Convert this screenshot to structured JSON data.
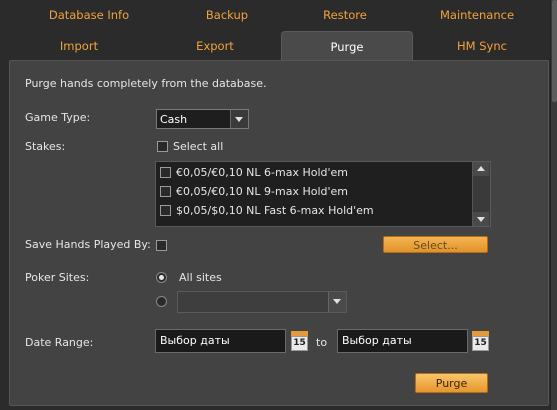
{
  "tabs": {
    "row1": [
      "Database Info",
      "Backup",
      "Restore",
      "Maintenance"
    ],
    "row2": [
      "Import",
      "Export",
      "Purge",
      "HM Sync"
    ],
    "active": "Purge"
  },
  "purge": {
    "description": "Purge hands completely from the database.",
    "game_type_label": "Game Type:",
    "game_type_value": "Cash",
    "stakes_label": "Stakes:",
    "select_all_label": "Select all",
    "stakes_items": [
      "€0,05/€0,10 NL 6-max  Hold'em",
      "€0,05/€0,10 NL 9-max  Hold'em",
      "$0,05/$0,10 NL Fast 6-max  Hold'em"
    ],
    "save_hands_label": "Save Hands Played By:",
    "select_button": "Select...",
    "poker_sites_label": "Poker Sites:",
    "all_sites_label": "All sites",
    "site_combo_value": "",
    "date_range_label": "Date Range:",
    "date_from_placeholder": "Выбор даты",
    "date_to_placeholder": "Выбор даты",
    "to_label": "to",
    "calendar_day": "15",
    "purge_button": "Purge"
  },
  "colors": {
    "tab_text": "#f2a23c",
    "accent_button": "#e9962c",
    "background": "#2b2b2b",
    "panel": "#434343"
  },
  "icons": [
    "calendar-icon",
    "dropdown-arrow-icon",
    "scroll-up-icon",
    "scroll-down-icon"
  ]
}
